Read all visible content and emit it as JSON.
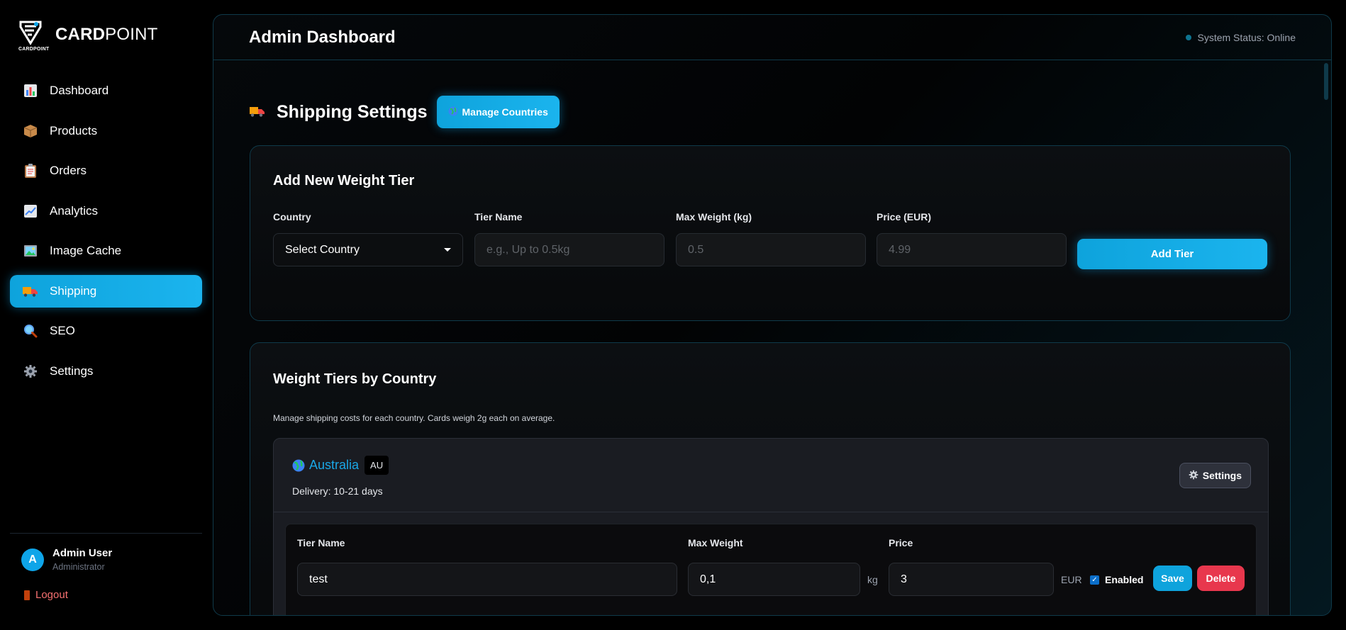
{
  "brand": {
    "name_bold": "CARD",
    "name_rest": "POINT",
    "mini_label": "CARDPOINT"
  },
  "sidebar": {
    "items": [
      {
        "label": "Dashboard",
        "icon": "chart-icon"
      },
      {
        "label": "Products",
        "icon": "package-icon"
      },
      {
        "label": "Orders",
        "icon": "clipboard-icon"
      },
      {
        "label": "Analytics",
        "icon": "trend-chart-icon"
      },
      {
        "label": "Image Cache",
        "icon": "picture-icon"
      },
      {
        "label": "Shipping",
        "icon": "truck-icon",
        "active": true
      },
      {
        "label": "SEO",
        "icon": "magnifier-icon"
      },
      {
        "label": "Settings",
        "icon": "gear-icon"
      }
    ],
    "user": {
      "initial": "A",
      "name": "Admin User",
      "role": "Administrator"
    },
    "logout_label": "Logout"
  },
  "header": {
    "title": "Admin Dashboard",
    "status": "System Status: Online"
  },
  "shipping": {
    "title": "Shipping Settings",
    "manage_countries_label": "Manage Countries",
    "add_tier": {
      "title": "Add New Weight Tier",
      "fields": {
        "country": {
          "label": "Country",
          "value": "Select Country"
        },
        "tier_name": {
          "label": "Tier Name",
          "placeholder": "e.g., Up to 0.5kg"
        },
        "max_weight": {
          "label": "Max Weight (kg)",
          "placeholder": "0.5"
        },
        "price": {
          "label": "Price (EUR)",
          "placeholder": "4.99"
        }
      },
      "button_label": "Add Tier"
    },
    "tiers": {
      "title": "Weight Tiers by Country",
      "description": "Manage shipping costs for each country. Cards weigh 2g each on average.",
      "countries": [
        {
          "name": "Australia",
          "code": "AU",
          "delivery": "Delivery: 10-21 days",
          "settings_label": "Settings",
          "rows": [
            {
              "tier_name_label": "Tier Name",
              "tier_name": "test",
              "max_weight_label": "Max Weight",
              "max_weight": "0,1",
              "weight_unit": "kg",
              "price_label": "Price",
              "price": "3",
              "currency": "EUR",
              "enabled_label": "Enabled",
              "enabled": true,
              "save_label": "Save",
              "delete_label": "Delete"
            }
          ]
        }
      ]
    }
  },
  "colors": {
    "accent": "#0ea5e9",
    "danger": "#e8374d",
    "border": "#0f3a4a"
  }
}
